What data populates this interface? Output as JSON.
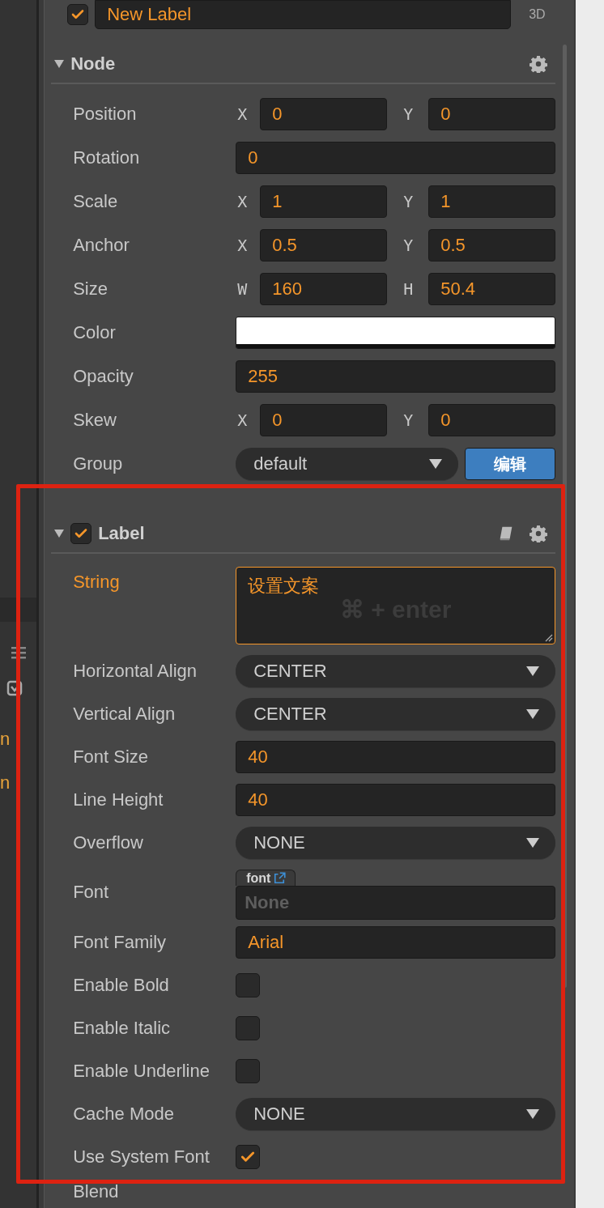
{
  "left_panel": {
    "items": [
      {
        "text": "n"
      },
      {
        "text": "n"
      }
    ]
  },
  "header": {
    "enabled": true,
    "name": "New Label",
    "badge": "3D"
  },
  "sections": [
    {
      "title": "Node",
      "expanded": true,
      "kind": "plain",
      "rows": [
        {
          "kind": "xy",
          "label": "Position",
          "active": false,
          "axes": [
            "X",
            "Y"
          ],
          "values": [
            "0",
            "0"
          ]
        },
        {
          "kind": "text",
          "label": "Rotation",
          "active": false,
          "value": "0"
        },
        {
          "kind": "xy",
          "label": "Scale",
          "active": false,
          "axes": [
            "X",
            "Y"
          ],
          "values": [
            "1",
            "1"
          ]
        },
        {
          "kind": "xy",
          "label": "Anchor",
          "active": false,
          "axes": [
            "X",
            "Y"
          ],
          "values": [
            "0.5",
            "0.5"
          ]
        },
        {
          "kind": "xy",
          "label": "Size",
          "active": false,
          "axes": [
            "W",
            "H"
          ],
          "values": [
            "160",
            "50.4"
          ]
        },
        {
          "kind": "color",
          "label": "Color",
          "active": false,
          "color": "#ffffff"
        },
        {
          "kind": "text",
          "label": "Opacity",
          "active": false,
          "value": "255"
        },
        {
          "kind": "xy",
          "label": "Skew",
          "active": false,
          "axes": [
            "X",
            "Y"
          ],
          "values": [
            "0",
            "0"
          ]
        },
        {
          "kind": "select-button",
          "label": "Group",
          "active": false,
          "value": "default",
          "button": "编辑"
        }
      ]
    },
    {
      "title": "Label",
      "expanded": true,
      "kind": "component",
      "enabled": true,
      "rows": [
        {
          "kind": "textarea",
          "label": "String",
          "active": true,
          "value": "设置文案",
          "hint": "⌘ + enter"
        },
        {
          "kind": "select",
          "label": "Horizontal Align",
          "active": false,
          "value": "CENTER"
        },
        {
          "kind": "select",
          "label": "Vertical Align",
          "active": false,
          "value": "CENTER"
        },
        {
          "kind": "text",
          "label": "Font Size",
          "active": false,
          "value": "40"
        },
        {
          "kind": "text",
          "label": "Line Height",
          "active": false,
          "value": "40"
        },
        {
          "kind": "select",
          "label": "Overflow",
          "active": false,
          "value": "NONE"
        },
        {
          "kind": "asset",
          "label": "Font",
          "active": false,
          "tab": "font",
          "placeholder": "None"
        },
        {
          "kind": "text",
          "label": "Font Family",
          "active": false,
          "value": "Arial"
        },
        {
          "kind": "checkbox",
          "label": "Enable Bold",
          "active": false,
          "checked": false
        },
        {
          "kind": "checkbox",
          "label": "Enable Italic",
          "active": false,
          "checked": false
        },
        {
          "kind": "checkbox",
          "label": "Enable Underline",
          "active": false,
          "checked": false
        },
        {
          "kind": "select",
          "label": "Cache Mode",
          "active": false,
          "value": "NONE"
        },
        {
          "kind": "checkbox",
          "label": "Use System Font",
          "active": false,
          "checked": true
        }
      ]
    }
  ],
  "trailing_label": "Blend",
  "annotation": {
    "kind": "highlight-box"
  }
}
